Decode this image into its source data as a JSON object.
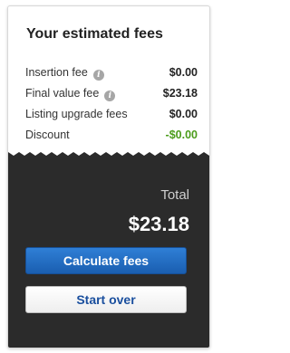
{
  "title": "Your estimated fees",
  "fees": [
    {
      "label": "Insertion fee",
      "value": "$0.00",
      "info_icon": "info-icon"
    },
    {
      "label": "Final value fee",
      "value": "$23.18",
      "info_icon": "info-icon"
    },
    {
      "label": "Listing upgrade fees",
      "value": "$0.00"
    },
    {
      "label": "Discount",
      "value": "-$0.00"
    }
  ],
  "total": {
    "label": "Total",
    "value": "$23.18"
  },
  "buttons": {
    "calculate": "Calculate fees",
    "start_over": "Start over"
  },
  "colors": {
    "accent": "#1a5eb0",
    "discount": "#4b9c1b",
    "dark_panel": "#2b2b2b"
  },
  "icons": {
    "info": "i"
  }
}
